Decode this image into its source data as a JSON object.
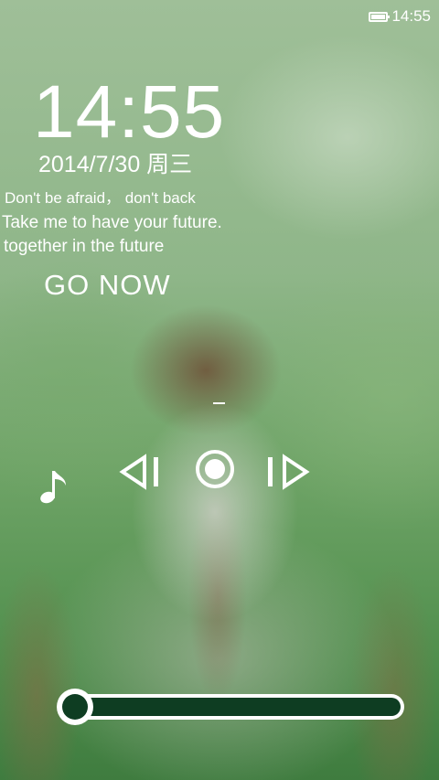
{
  "status_bar": {
    "battery_icon": "battery-full-icon",
    "time": "14:55"
  },
  "lock_screen": {
    "clock": "14:55",
    "date": "2014/7/30 周三",
    "quote_lines": [
      "Don't be afraid， don't back",
      "Take me to have your future.",
      "together in the future"
    ],
    "go_now_label": "GO NOW",
    "track_title": "-"
  },
  "player": {
    "icons": [
      "music-note-icon",
      "previous-icon",
      "play-pause-icon",
      "next-icon"
    ],
    "accent_color": "#0e3d22"
  },
  "unlock_slider": {
    "position": 0.0
  }
}
